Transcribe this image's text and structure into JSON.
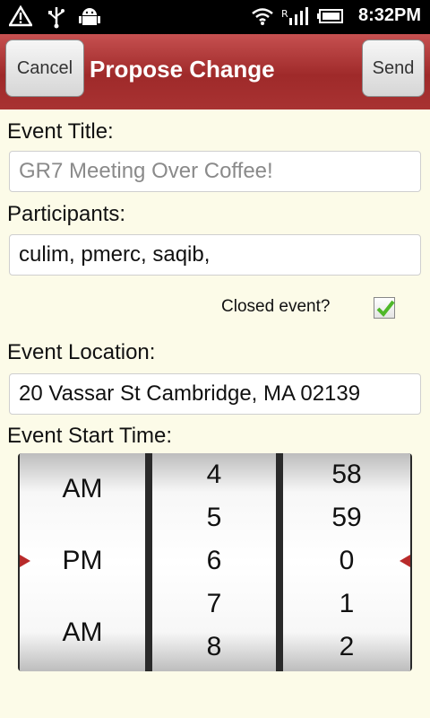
{
  "status_bar": {
    "time": "8:32PM",
    "icons": [
      "warning-icon",
      "usb-icon",
      "android-icon",
      "wifi-icon",
      "signal-icon",
      "battery-icon"
    ]
  },
  "titlebar": {
    "title": "Propose Change",
    "cancel_label": "Cancel",
    "send_label": "Send"
  },
  "form": {
    "event_title_label": "Event Title:",
    "event_title_placeholder": "GR7 Meeting Over Coffee!",
    "participants_label": "Participants:",
    "participants_value": "culim, pmerc, saqib,",
    "closed_event_label": "Closed event?",
    "closed_event_checked": true,
    "location_label": "Event Location:",
    "location_value": "20 Vassar St Cambridge, MA 02139",
    "start_time_label": "Event Start Time:"
  },
  "picker": {
    "ampm": [
      "AM",
      "PM",
      "AM"
    ],
    "hours": [
      "4",
      "5",
      "6",
      "7",
      "8"
    ],
    "minutes": [
      "58",
      "59",
      "0",
      "1",
      "2"
    ],
    "selected": {
      "ampm": "PM",
      "hour": "6",
      "minute": "0"
    }
  },
  "colors": {
    "accent": "#a83232",
    "background": "#fcfbe8",
    "check": "#4fb82a"
  }
}
